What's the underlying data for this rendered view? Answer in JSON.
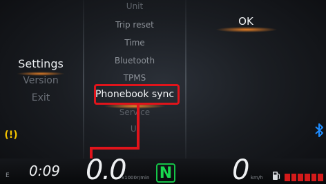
{
  "left_menu": {
    "items": [
      {
        "label": "Settings",
        "active": true
      },
      {
        "label": "Version",
        "active": false
      },
      {
        "label": "Exit",
        "active": false
      }
    ]
  },
  "middle_menu": {
    "items": [
      {
        "label": "Unit"
      },
      {
        "label": "Trip reset"
      },
      {
        "label": "Time"
      },
      {
        "label": "Bluetooth"
      },
      {
        "label": "TPMS"
      },
      {
        "label": "Phonebook sync",
        "selected": true
      },
      {
        "label": "Service"
      },
      {
        "label": "UI"
      }
    ]
  },
  "right_panel": {
    "ok_label": "OK"
  },
  "status_bar": {
    "e_label": "E",
    "time": "0:09",
    "rpm": "0.0",
    "rpm_unit": "x1000r/min",
    "gear": "N",
    "speed": "0",
    "speed_unit": "km/h",
    "fuel_level_segments": 6,
    "fuel_segments_filled": 6
  },
  "icons": {
    "warning": "warning-icon",
    "bluetooth": "bluetooth-icon",
    "fuel": "fuel-pump-icon"
  },
  "colors": {
    "highlight_red": "#e0141b",
    "accent_orange": "#ff8c28",
    "gear_green": "#19d84f",
    "warning_yellow": "#f2c200",
    "bluetooth_blue": "#1e8cff"
  }
}
